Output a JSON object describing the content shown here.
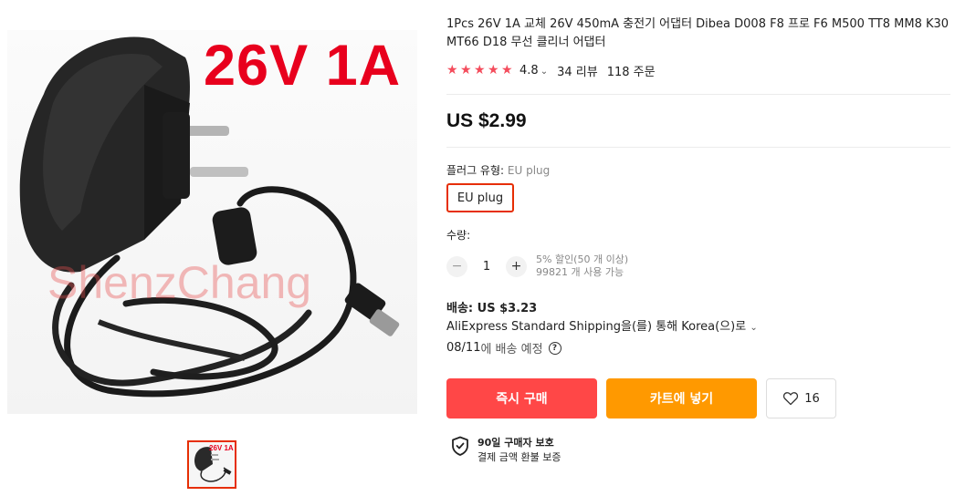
{
  "product": {
    "title": "1Pcs 26V 1A 교체 26V 450mA 충전기 어댑터 Dibea D008 F8 프로 F6 M500 TT8 MM8 K30 MT66 D18 무선 클리너 어댑터",
    "image_label": "26V 1A",
    "watermark": "ShenzChang",
    "thumb_label": "26V 1A"
  },
  "rating": {
    "value": "4.8",
    "stars": 5,
    "reviews": "34 리뷰",
    "orders": "118 주문"
  },
  "price": "US $2.99",
  "plug": {
    "label": "플러그 유형:",
    "selected": "EU plug",
    "option": "EU plug"
  },
  "quantity": {
    "label": "수량:",
    "value": "1",
    "discount": "5% 할인(50 개 이상)",
    "available": "99821 개 사용 가능",
    "minus": "−",
    "plus": "+"
  },
  "shipping": {
    "label": "배송: US $3.23",
    "method": "AliExpress Standard Shipping을(를) 통해 Korea(으)로",
    "date": "08/11",
    "date_suffix": "에 배송 예정",
    "help": "?"
  },
  "actions": {
    "buy_now": "즉시 구매",
    "add_to_cart": "카트에 넣기",
    "wishlist_count": "16"
  },
  "protection": {
    "title": "90일 구매자 보호",
    "subtitle": "결제 금액 환불 보증"
  },
  "colors": {
    "accent_red": "#ff4747",
    "cart_orange": "#ff9900",
    "star": "#f44c5c",
    "selected_border": "#e62e04"
  }
}
